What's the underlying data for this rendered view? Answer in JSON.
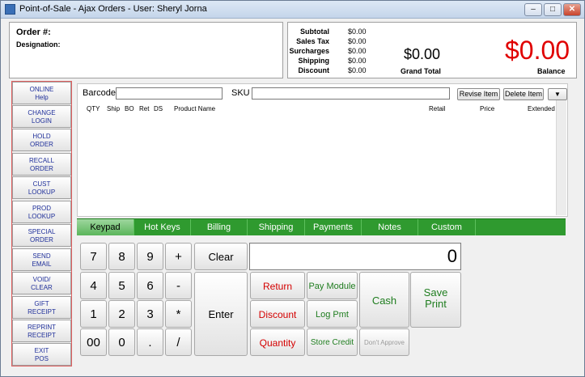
{
  "window": {
    "title": "Point-of-Sale - Ajax Orders - User: Sheryl Jorna",
    "min_label": "–",
    "max_label": "□",
    "close_label": "✕"
  },
  "order": {
    "order_label": "Order #:",
    "designation_label": "Designation:"
  },
  "totals": {
    "rows": [
      {
        "label": "Subtotal",
        "value": "$0.00"
      },
      {
        "label": "Sales Tax",
        "value": "$0.00"
      },
      {
        "label": "Surcharges",
        "value": "$0.00"
      },
      {
        "label": "Shipping",
        "value": "$0.00"
      },
      {
        "label": "Discount",
        "value": "$0.00"
      }
    ],
    "grand_total_value": "$0.00",
    "grand_total_label": "Grand Total",
    "balance_value": "$0.00",
    "balance_label": "Balance",
    "balance_color": "#e00000"
  },
  "sidebar": {
    "items": [
      {
        "line1": "ONLINE",
        "line2": "Help"
      },
      {
        "line1": "CHANGE",
        "line2": "LOGIN"
      },
      {
        "line1": "HOLD",
        "line2": "ORDER"
      },
      {
        "line1": "RECALL",
        "line2": "ORDER"
      },
      {
        "line1": "CUST",
        "line2": "LOOKUP"
      },
      {
        "line1": "PROD",
        "line2": "LOOKUP"
      },
      {
        "line1": "SPECIAL",
        "line2": "ORDER"
      },
      {
        "line1": "SEND",
        "line2": "EMAIL"
      },
      {
        "line1": "VOID/",
        "line2": "CLEAR"
      },
      {
        "line1": "GIFT",
        "line2": "RECEIPT"
      },
      {
        "line1": "REPRINT",
        "line2": "RECEIPT"
      },
      {
        "line1": "EXIT",
        "line2": "POS"
      }
    ]
  },
  "items": {
    "barcode_label": "Barcode",
    "sku_label": "SKU",
    "barcode_value": "",
    "sku_value": "",
    "revise_label": "Revise Item",
    "delete_label": "Delete Item",
    "dropdown_label": "▼",
    "columns": [
      "QTY",
      "Ship",
      "BO",
      "Ret",
      "DS",
      "Product Name",
      "Retail",
      "Price",
      "Extended"
    ]
  },
  "tabs": [
    "Keypad",
    "Hot Keys",
    "Billing",
    "Shipping",
    "Payments",
    "Notes",
    "Custom"
  ],
  "keypad": {
    "display_value": "0",
    "clear_label": "Clear",
    "enter_label": "Enter",
    "keys": [
      "7",
      "8",
      "9",
      "+",
      "4",
      "5",
      "6",
      "-",
      "1",
      "2",
      "3",
      "*",
      "00",
      "0",
      ".",
      "/"
    ],
    "return_label": "Return",
    "discount_label": "Discount",
    "quantity_label": "Quantity",
    "pay_module_label": "Pay Module",
    "log_pmt_label": "Log Pmt",
    "store_credit_label": "Store Credit",
    "cash_label": "Cash",
    "save_label": "Save",
    "print_label": "Print",
    "dont_approve_label": "Don't Approve"
  },
  "colors": {
    "accent_green": "#2f9a2f",
    "sidebar_text": "#1f2f9a",
    "action_red": "#d40000"
  }
}
